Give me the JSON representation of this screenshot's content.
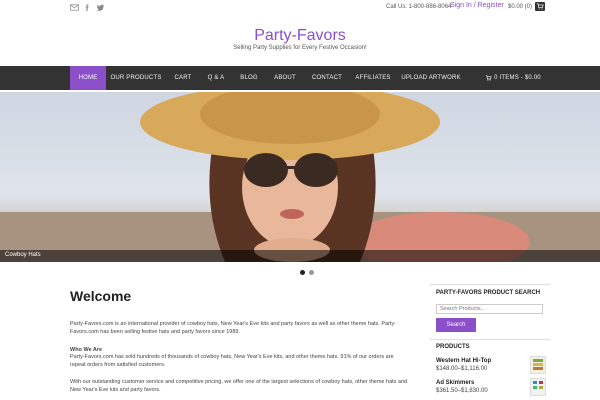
{
  "topbar": {
    "call": "Call Us: 1-800-886-8064",
    "signin": "Sign In / Register",
    "cart_mini": "$0.00 (0)"
  },
  "header": {
    "brand": "Party-Favors",
    "tagline": "Selling Party Supplies for Every Festive Occasion!"
  },
  "nav": {
    "items": [
      {
        "label": "HOME"
      },
      {
        "label": "OUR PRODUCTS"
      },
      {
        "label": "CART"
      },
      {
        "label": "Q & A"
      },
      {
        "label": "BLOG"
      },
      {
        "label": "ABOUT"
      },
      {
        "label": "CONTACT"
      },
      {
        "label": "AFFILIATES"
      },
      {
        "label": "UPLOAD ARTWORK"
      }
    ],
    "cart": "0 ITEMS - $0.00",
    "active_color": "#8b50c9"
  },
  "hero": {
    "caption": "Cowboy Hats"
  },
  "main": {
    "title": "Welcome",
    "p1": "Party-Favors.com is an international provider of cowboy hats, New Year's Eve kits and party favors as well as other theme hats. Party-Favors.com has been selling festive hats and party favors since 1989.",
    "who_heading": "Who We Are",
    "p2": "Party-Favors.com has sold hundreds of thousands of cowboy hats, New Year's Eve kits, and other theme hats. 91% of our orders are repeat orders from satisfied customers.",
    "p3": "With our outstanding customer service and competitive pricing, we offer one of the largest selections of cowboy hats, other theme hats and New Year's Eve kits and party favors."
  },
  "sidebar": {
    "search_title": "PARTY-FAVORS PRODUCT SEARCH",
    "search_placeholder": "Search Products...",
    "search_button": "Search",
    "products_title": "PRODUCTS",
    "products": [
      {
        "name": "Western Hat Hi-Top",
        "price": "$148.00–$1,116.00"
      },
      {
        "name": "Ad Skimmers",
        "price": "$361.50–$1,830.00"
      }
    ]
  }
}
